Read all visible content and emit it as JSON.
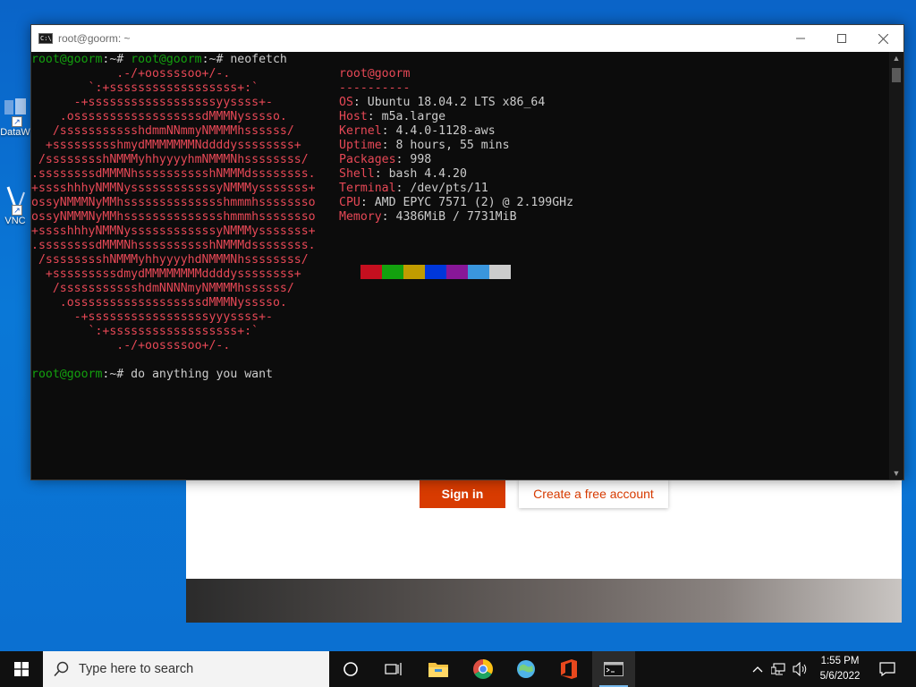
{
  "desktop": {
    "icons": [
      {
        "label": "DataW",
        "icon": "database-app-icon"
      },
      {
        "label": "VNC",
        "icon": "vnc-viewer-icon"
      }
    ]
  },
  "webpage": {
    "signin_label": "Sign in",
    "create_label": "Create a free account",
    "accent": "#d83b01"
  },
  "console": {
    "title": "root@goorm: ~",
    "prompt_user": "root@goorm",
    "prompt_sep": ":~# ",
    "command": "neofetch",
    "logo": [
      "            .-/+oossssoo+/-.",
      "        `:+ssssssssssssssssss+:`",
      "      -+ssssssssssssssssssyyssss+-",
      "    .ossssssssssssssssssdMMMNysssso.",
      "   /ssssssssssshdmmNNmmyNMMMMhssssss/",
      "  +ssssssssshmydMMMMMMMNddddyssssssss+",
      " /sssssssshNMMMyhhyyyyhmNMMMNhssssssss/",
      ".ssssssssdMMMNhsssssssssshNMMMdssssssss.",
      "+sssshhhyNMMNyssssssssssssyNMMMysssssss+",
      "ossyNMMMNyMMhsssssssssssssshmmmhssssssso",
      "ossyNMMMNyMMhsssssssssssssshmmmhssssssso",
      "+sssshhhyNMMNyssssssssssssyNMMMysssssss+",
      ".ssssssssdMMMNhsssssssssshNMMMdssssssss.",
      " /sssssssshNMMMyhhyyyyhdNMMMNhssssssss/",
      "  +sssssssssdmydMMMMMMMMddddyssssssss+",
      "   /ssssssssssshdmNNNNmyNMMMMhssssss/",
      "    .ossssssssssssssssssdMMMNysssso.",
      "      -+sssssssssssssssssyyyssss+-",
      "        `:+ssssssssssssssssss+:`",
      "            .-/+oossssoo+/-."
    ],
    "info_header": "root@goorm",
    "info_rule": "----------",
    "info": [
      {
        "key": "OS",
        "value": "Ubuntu 18.04.2 LTS x86_64"
      },
      {
        "key": "Host",
        "value": "m5a.large"
      },
      {
        "key": "Kernel",
        "value": "4.4.0-1128-aws"
      },
      {
        "key": "Uptime",
        "value": "8 hours, 55 mins"
      },
      {
        "key": "Packages",
        "value": "998"
      },
      {
        "key": "Shell",
        "value": "bash 4.4.20"
      },
      {
        "key": "Terminal",
        "value": "/dev/pts/11"
      },
      {
        "key": "CPU",
        "value": "AMD EPYC 7571 (2) @ 2.199GHz"
      },
      {
        "key": "Memory",
        "value": "4386MiB / 7731MiB"
      }
    ],
    "palette": [
      "#c50f1f",
      "#13a10e",
      "#c19c00",
      "#0037da",
      "#881798",
      "#3a96dd",
      "#cccccc"
    ],
    "last_command": "do anything you want",
    "colors": {
      "prompt": "#13a10e",
      "logo": "#e74856",
      "text": "#cccccc",
      "background": "#0c0c0c"
    }
  },
  "taskbar": {
    "search_placeholder": "Type here to search",
    "apps": [
      "cortana-icon",
      "task-view-icon",
      "file-explorer-icon",
      "chrome-icon",
      "globe-app-icon",
      "office-icon",
      "terminal-icon"
    ],
    "time": "1:55 PM",
    "date": "5/6/2022"
  }
}
